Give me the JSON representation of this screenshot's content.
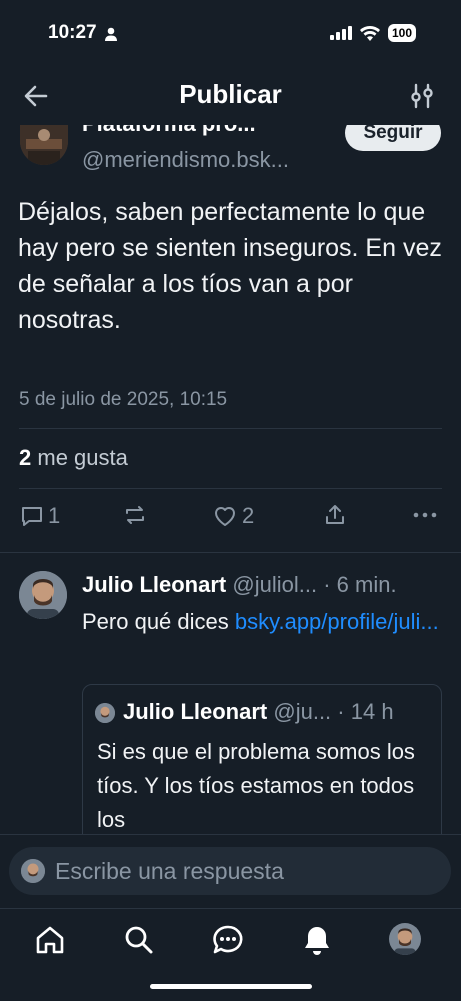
{
  "status": {
    "time": "10:27",
    "battery": "100"
  },
  "header": {
    "title": "Publicar"
  },
  "op": {
    "name": "Plataforma pro...",
    "handle": "@meriendismo.bsk...",
    "follow_label": "Seguir",
    "text": "Déjalos, saben perfectamente lo que hay pero se sienten inseguros. En vez de señalar a los tíos van a por nosotras.",
    "date": "5 de julio de 2025, 10:15",
    "likes_count": "2",
    "likes_label": "me gusta",
    "actions": {
      "replies": "1",
      "likes": "2"
    }
  },
  "reply": {
    "name": "Julio Lleonart",
    "handle": "@juliol...",
    "time": "· 6 min.",
    "text": "Pero qué dices ",
    "link": "bsky.app/​profile/juli...",
    "quote": {
      "name": "Julio Lleonart",
      "handle": "@ju...",
      "time": "· 14 h",
      "text": "Si es que el problema somos los tíos. Y los tíos estamos en todos los"
    }
  },
  "composer": {
    "placeholder": "Escribe una respuesta"
  },
  "colors": {
    "background": "#161e27",
    "link": "#1f8dff",
    "muted": "#8a96a3"
  },
  "icons": [
    "back-arrow-icon",
    "filter-sliders-icon",
    "comment-icon",
    "repost-icon",
    "heart-icon",
    "share-icon",
    "more-icon",
    "home-icon",
    "search-icon",
    "chat-icon",
    "bell-icon",
    "profile-avatar"
  ]
}
